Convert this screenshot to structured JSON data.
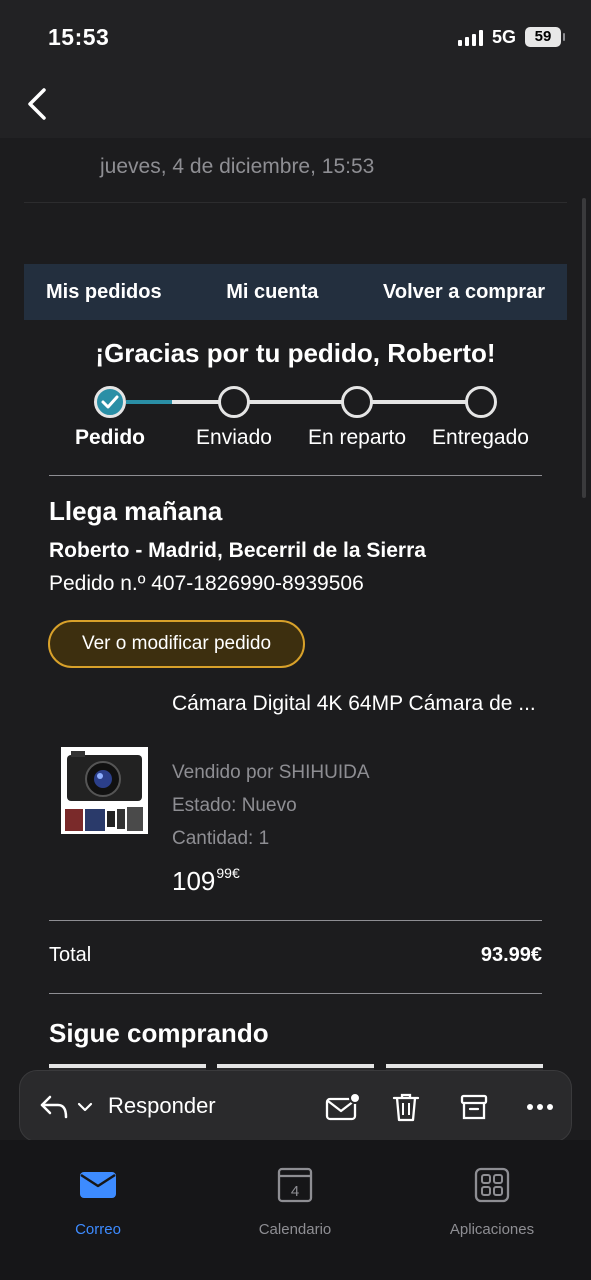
{
  "status_bar": {
    "time": "15:53",
    "network": "5G",
    "battery": "59"
  },
  "mail": {
    "date": "jueves, 4 de diciembre, 15:53",
    "nav_links": [
      "Mis pedidos",
      "Mi cuenta",
      "Volver a comprar"
    ],
    "thanks": "¡Gracias por tu pedido, Roberto!",
    "progress": {
      "steps": [
        "Pedido",
        "Enviado",
        "En reparto",
        "Entregado"
      ],
      "current_index": 0
    },
    "delivery": {
      "heading": "Llega mañana",
      "address": "Roberto - Madrid, Becerril de la Sierra",
      "order_number": "Pedido n.º 407-1826990-8939506"
    },
    "modify_button": "Ver o modificar pedido",
    "product": {
      "title": "Cámara Digital 4K 64MP Cámara de ...",
      "seller": "Vendido por SHIHUIDA",
      "condition": "Estado: Nuevo",
      "quantity": "Cantidad: 1",
      "price_main": "109",
      "price_fraction": "99€"
    },
    "total": {
      "label": "Total",
      "value": "93.99€"
    },
    "keep_shopping": "Sigue comprando"
  },
  "toolbar": {
    "reply_label": "Responder"
  },
  "tabbar": {
    "tabs": [
      {
        "label": "Correo",
        "icon": "mail-icon",
        "active": true
      },
      {
        "label": "Calendario",
        "icon": "calendar-icon",
        "badge": "4",
        "active": false
      },
      {
        "label": "Aplicaciones",
        "icon": "apps-grid-icon",
        "active": false
      }
    ]
  },
  "colors": {
    "accent_blue": "#3d8bff",
    "progress_teal": "#2a8fa6",
    "amazon_nav": "#232f3e",
    "button_border": "#d8a12a"
  }
}
